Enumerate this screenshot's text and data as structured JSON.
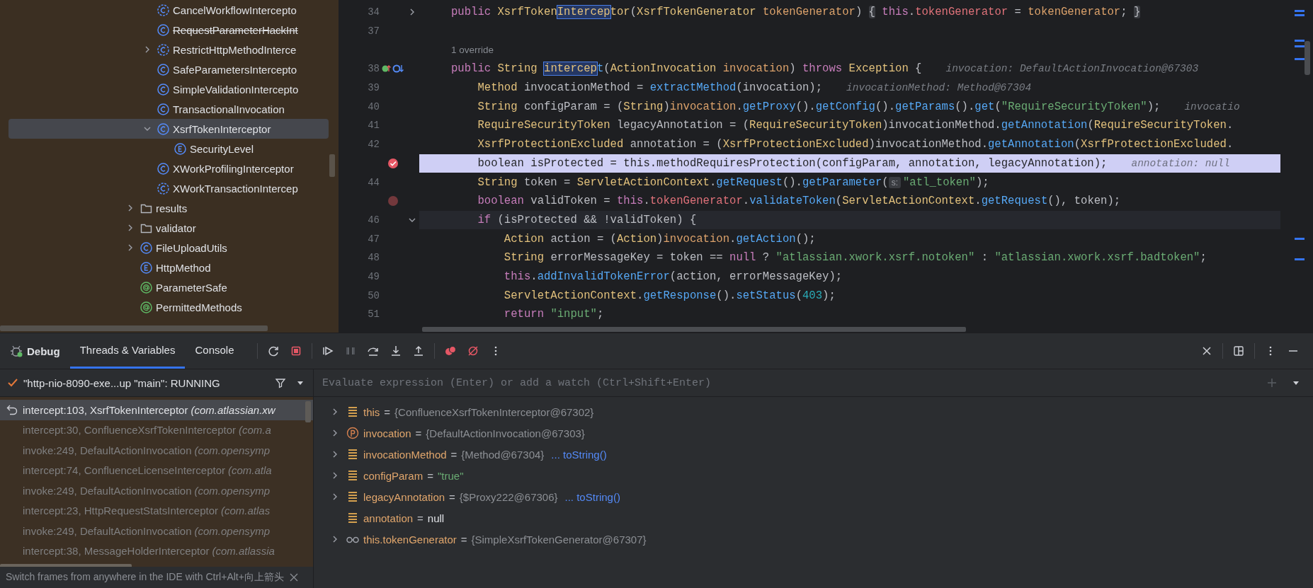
{
  "project_tree": {
    "items": [
      {
        "children": [
          {
            "kind": "abstract-class",
            "label": "CancelWorkflowIntercepto",
            "selected": false,
            "deprecated": false
          },
          {
            "kind": "class",
            "label": "RequestParameterHackInt",
            "selected": false,
            "deprecated": true
          },
          {
            "kind": "abstract-class",
            "label": "RestrictHttpMethodInterce",
            "expanded": false,
            "selected": false,
            "deprecated": false
          },
          {
            "kind": "class",
            "label": "SafeParametersIntercepto",
            "selected": false,
            "deprecated": false
          },
          {
            "kind": "class",
            "label": "SimpleValidationIntercepto",
            "selected": false,
            "deprecated": false
          },
          {
            "kind": "class",
            "label": "TransactionalInvocation",
            "selected": false,
            "deprecated": false
          },
          {
            "kind": "class",
            "label": "XsrfTokenInterceptor",
            "expanded": true,
            "selected": true,
            "deprecated": false,
            "children": [
              {
                "kind": "enum",
                "label": "SecurityLevel",
                "selected": false,
                "deprecated": false
              }
            ]
          },
          {
            "kind": "class",
            "label": "XWorkProfilingInterceptor",
            "selected": false,
            "deprecated": false
          },
          {
            "kind": "abstract-class",
            "label": "XWorkTransactionIntercep",
            "selected": false,
            "deprecated": false
          }
        ]
      },
      {
        "kind": "folder",
        "label": "results",
        "expanded": false,
        "selected": false,
        "deprecated": false
      },
      {
        "kind": "folder",
        "label": "validator",
        "expanded": false,
        "selected": false,
        "deprecated": false
      },
      {
        "kind": "class",
        "label": "FileUploadUtils",
        "expanded": false,
        "selected": false,
        "deprecated": false
      },
      {
        "kind": "enum",
        "label": "HttpMethod",
        "selected": false,
        "deprecated": false
      },
      {
        "kind": "annotation",
        "label": "ParameterSafe",
        "selected": false,
        "deprecated": false
      },
      {
        "kind": "annotation",
        "label": "PermittedMethods",
        "selected": false,
        "deprecated": false
      }
    ]
  },
  "editor": {
    "lines": [
      {
        "kind": "code",
        "number": "34",
        "expanded": false,
        "tokens": [
          {
            "kind": "kw",
            "text": "public "
          },
          {
            "kind": "type",
            "text": "XsrfToken"
          },
          {
            "kind": "match",
            "text": "Intercep"
          },
          {
            "kind": "type",
            "text": "tor"
          },
          {
            "kind": "plain",
            "text": "("
          },
          {
            "kind": "type",
            "text": "XsrfTokenGenerator "
          },
          {
            "kind": "param",
            "text": "tokenGenerator"
          },
          {
            "kind": "plain",
            "text": ") "
          },
          {
            "kind": "foldmark",
            "text": "{"
          },
          {
            "kind": "kw",
            "text": " this"
          },
          {
            "kind": "plain",
            "text": "."
          },
          {
            "kind": "field",
            "text": "tokenGenerator"
          },
          {
            "kind": "plain",
            "text": " = "
          },
          {
            "kind": "param",
            "text": "tokenGenerator"
          },
          {
            "kind": "plain",
            "text": "; "
          },
          {
            "kind": "foldmark",
            "text": "}"
          }
        ]
      },
      {
        "kind": "code",
        "number": "37"
      },
      {
        "kind": "lens",
        "text": "1 override"
      },
      {
        "kind": "code",
        "number": "38",
        "overrides": true,
        "tokens": [
          {
            "kind": "kw",
            "text": "public "
          },
          {
            "kind": "type",
            "text": "String "
          },
          {
            "kind": "match",
            "text": "intercep"
          },
          {
            "kind": "method",
            "text": "t"
          },
          {
            "kind": "plain",
            "text": "("
          },
          {
            "kind": "type",
            "text": "ActionInvocation "
          },
          {
            "kind": "param",
            "text": "invocation"
          },
          {
            "kind": "plain",
            "text": ") "
          },
          {
            "kind": "kw",
            "text": "throws "
          },
          {
            "kind": "type",
            "text": "Exception "
          },
          {
            "kind": "plain",
            "text": "{"
          },
          {
            "kind": "hint",
            "text": "invocation: DefaultActionInvocation@67303"
          }
        ]
      },
      {
        "kind": "code",
        "number": "39",
        "tokens": [
          {
            "kind": "type",
            "text": "    Method "
          },
          {
            "kind": "plain",
            "text": "invocationMethod = "
          },
          {
            "kind": "method",
            "text": "extractMethod"
          },
          {
            "kind": "plain",
            "text": "(invocation);"
          },
          {
            "kind": "hint",
            "text": "invocationMethod: Method@67304"
          }
        ]
      },
      {
        "kind": "code",
        "number": "40",
        "tokens": [
          {
            "kind": "type",
            "text": "    String "
          },
          {
            "kind": "plain",
            "text": "configParam = ("
          },
          {
            "kind": "type",
            "text": "String"
          },
          {
            "kind": "plain",
            "text": ")"
          },
          {
            "kind": "param",
            "text": "invocation"
          },
          {
            "kind": "plain",
            "text": "."
          },
          {
            "kind": "method",
            "text": "getProxy"
          },
          {
            "kind": "plain",
            "text": "()."
          },
          {
            "kind": "method",
            "text": "getConfig"
          },
          {
            "kind": "plain",
            "text": "()."
          },
          {
            "kind": "method",
            "text": "getParams"
          },
          {
            "kind": "plain",
            "text": "()."
          },
          {
            "kind": "method",
            "text": "get"
          },
          {
            "kind": "plain",
            "text": "("
          },
          {
            "kind": "string",
            "text": "\"RequireSecurityToken\""
          },
          {
            "kind": "plain",
            "text": ");"
          },
          {
            "kind": "hint",
            "text": "invocatio"
          }
        ]
      },
      {
        "kind": "code",
        "number": "41",
        "tokens": [
          {
            "kind": "type",
            "text": "    RequireSecurityToken "
          },
          {
            "kind": "plain",
            "text": "legacyAnnotation = ("
          },
          {
            "kind": "type",
            "text": "RequireSecurityToken"
          },
          {
            "kind": "plain",
            "text": ")invocationMethod."
          },
          {
            "kind": "method",
            "text": "getAnnotation"
          },
          {
            "kind": "plain",
            "text": "("
          },
          {
            "kind": "type",
            "text": "RequireSecurityToken"
          },
          {
            "kind": "plain",
            "text": "."
          }
        ]
      },
      {
        "kind": "code",
        "number": "42",
        "tokens": [
          {
            "kind": "type",
            "text": "    XsrfProtectionExcluded "
          },
          {
            "kind": "plain",
            "text": "annotation = ("
          },
          {
            "kind": "type",
            "text": "XsrfProtectionExcluded"
          },
          {
            "kind": "plain",
            "text": ")invocationMethod."
          },
          {
            "kind": "method",
            "text": "getAnnotation"
          },
          {
            "kind": "plain",
            "text": "("
          },
          {
            "kind": "type",
            "text": "XsrfProtectionExcluded"
          },
          {
            "kind": "plain",
            "text": "."
          }
        ]
      },
      {
        "kind": "code",
        "breakpoint": true,
        "paused": true,
        "tokens": [
          {
            "kind": "kw",
            "text": "    boolean "
          },
          {
            "kind": "plain",
            "text": "isProtected = "
          },
          {
            "kind": "kw",
            "text": "this"
          },
          {
            "kind": "plain",
            "text": ".methodRequiresProtection(configParam, annotation, legacyAnnotation);"
          },
          {
            "kind": "hint",
            "text": "annotation: null"
          }
        ]
      },
      {
        "kind": "code",
        "number": "44",
        "tokens": [
          {
            "kind": "type",
            "text": "    String "
          },
          {
            "kind": "plain",
            "text": "token = "
          },
          {
            "kind": "type",
            "text": "ServletActionContext"
          },
          {
            "kind": "plain",
            "text": "."
          },
          {
            "kind": "method",
            "text": "getRequest"
          },
          {
            "kind": "plain",
            "text": "()."
          },
          {
            "kind": "method",
            "text": "getParameter"
          },
          {
            "kind": "plain",
            "text": "("
          },
          {
            "kind": "inlay",
            "text": "s:"
          },
          {
            "kind": "string",
            "text": "\"atl_token\""
          },
          {
            "kind": "plain",
            "text": ");"
          }
        ]
      },
      {
        "kind": "code",
        "breakpoint": true,
        "paused": false,
        "tokens": [
          {
            "kind": "kw",
            "text": "    boolean "
          },
          {
            "kind": "plain",
            "text": "validToken = "
          },
          {
            "kind": "kw",
            "text": "this"
          },
          {
            "kind": "plain",
            "text": "."
          },
          {
            "kind": "field",
            "text": "tokenGenerator"
          },
          {
            "kind": "plain",
            "text": "."
          },
          {
            "kind": "method",
            "text": "validateToken"
          },
          {
            "kind": "plain",
            "text": "("
          },
          {
            "kind": "type",
            "text": "ServletActionContext"
          },
          {
            "kind": "plain",
            "text": "."
          },
          {
            "kind": "method",
            "text": "getRequest"
          },
          {
            "kind": "plain",
            "text": "(), token);"
          }
        ]
      },
      {
        "kind": "code",
        "number": "46",
        "expanded": true,
        "caret": true,
        "tokens": [
          {
            "kind": "kw",
            "text": "    if "
          },
          {
            "kind": "plain",
            "text": "(isProtected && !validToken) {"
          }
        ]
      },
      {
        "kind": "code",
        "number": "47",
        "tokens": [
          {
            "kind": "type",
            "text": "        Action "
          },
          {
            "kind": "plain",
            "text": "action = ("
          },
          {
            "kind": "type",
            "text": "Action"
          },
          {
            "kind": "plain",
            "text": ")"
          },
          {
            "kind": "param",
            "text": "invocation"
          },
          {
            "kind": "plain",
            "text": "."
          },
          {
            "kind": "method",
            "text": "getAction"
          },
          {
            "kind": "plain",
            "text": "();"
          }
        ]
      },
      {
        "kind": "code",
        "number": "48",
        "tokens": [
          {
            "kind": "type",
            "text": "        String "
          },
          {
            "kind": "plain",
            "text": "errorMessageKey = token == "
          },
          {
            "kind": "kw",
            "text": "null"
          },
          {
            "kind": "plain",
            "text": " ? "
          },
          {
            "kind": "string",
            "text": "\"atlassian.xwork.xsrf.notoken\""
          },
          {
            "kind": "plain",
            "text": " : "
          },
          {
            "kind": "string",
            "text": "\"atlassian.xwork.xsrf.badtoken\""
          },
          {
            "kind": "plain",
            "text": ";"
          }
        ]
      },
      {
        "kind": "code",
        "number": "49",
        "tokens": [
          {
            "kind": "kw",
            "text": "        this"
          },
          {
            "kind": "plain",
            "text": "."
          },
          {
            "kind": "method",
            "text": "addInvalidTokenError"
          },
          {
            "kind": "plain",
            "text": "(action, errorMessageKey);"
          }
        ]
      },
      {
        "kind": "code",
        "number": "50",
        "tokens": [
          {
            "kind": "type",
            "text": "        ServletActionContext"
          },
          {
            "kind": "plain",
            "text": "."
          },
          {
            "kind": "method",
            "text": "getResponse"
          },
          {
            "kind": "plain",
            "text": "()."
          },
          {
            "kind": "method",
            "text": "setStatus"
          },
          {
            "kind": "plain",
            "text": "("
          },
          {
            "kind": "number",
            "text": "403"
          },
          {
            "kind": "plain",
            "text": ");"
          }
        ]
      },
      {
        "kind": "code",
        "number": "51",
        "tokens": [
          {
            "kind": "kw",
            "text": "        return "
          },
          {
            "kind": "string",
            "text": "\"input\""
          },
          {
            "kind": "plain",
            "text": ";"
          }
        ]
      }
    ]
  },
  "debug": {
    "title": "Debug",
    "tabs": [
      {
        "label": "Threads & Variables",
        "selected": true
      },
      {
        "label": "Console",
        "selected": false
      }
    ],
    "thread": {
      "label": "\"http-nio-8090-exe...up \"main\": RUNNING"
    },
    "evaluate": {
      "placeholder": "Evaluate expression (Enter) or add a watch (Ctrl+Shift+Enter)"
    },
    "frames": [
      {
        "location": "intercept:103, XsrfTokenInterceptor",
        "package": "(com.atlassian.xw",
        "selected": true
      },
      {
        "location": "intercept:30, ConfluenceXsrfTokenInterceptor",
        "package": "(com.a",
        "selected": false
      },
      {
        "location": "invoke:249, DefaultActionInvocation",
        "package": "(com.opensymp",
        "selected": false
      },
      {
        "location": "intercept:74, ConfluenceLicenseInterceptor",
        "package": "(com.atla",
        "selected": false
      },
      {
        "location": "invoke:249, DefaultActionInvocation",
        "package": "(com.opensymp",
        "selected": false
      },
      {
        "location": "intercept:23, HttpRequestStatsInterceptor",
        "package": "(com.atlas",
        "selected": false
      },
      {
        "location": "invoke:249, DefaultActionInvocation",
        "package": "(com.opensymp",
        "selected": false
      },
      {
        "location": "intercept:38, MessageHolderInterceptor",
        "package": "(com.atlassia",
        "selected": false
      }
    ],
    "hint": "Switch frames from anywhere in the IDE with Ctrl+Alt+向上箭头",
    "variables": [
      {
        "kind": "field",
        "expandable": true,
        "name": "this",
        "operator": "=",
        "value": {
          "kind": "object",
          "text": "{ConfluenceXsrfTokenInterceptor@67302}"
        }
      },
      {
        "kind": "param",
        "expandable": true,
        "name": "invocation",
        "operator": "=",
        "value": {
          "kind": "object",
          "text": "{DefaultActionInvocation@67303}"
        }
      },
      {
        "kind": "field",
        "expandable": true,
        "name": "invocationMethod",
        "operator": "=",
        "value": {
          "kind": "object",
          "text": "{Method@67304}"
        },
        "link": "... toString()"
      },
      {
        "kind": "field",
        "expandable": true,
        "name": "configParam",
        "operator": "=",
        "value": {
          "kind": "string",
          "text": "\"true\""
        }
      },
      {
        "kind": "field",
        "expandable": true,
        "name": "legacyAnnotation",
        "operator": "=",
        "value": {
          "kind": "object",
          "text": "{$Proxy222@67306}"
        },
        "link": "... toString()"
      },
      {
        "kind": "field",
        "expandable": false,
        "name": "annotation",
        "operator": "=",
        "value": {
          "kind": "null",
          "text": "null"
        }
      },
      {
        "kind": "watch",
        "expandable": true,
        "name": "this.tokenGenerator",
        "operator": "=",
        "value": {
          "kind": "object",
          "text": "{SimpleXsrfTokenGenerator@67307}"
        }
      }
    ]
  }
}
